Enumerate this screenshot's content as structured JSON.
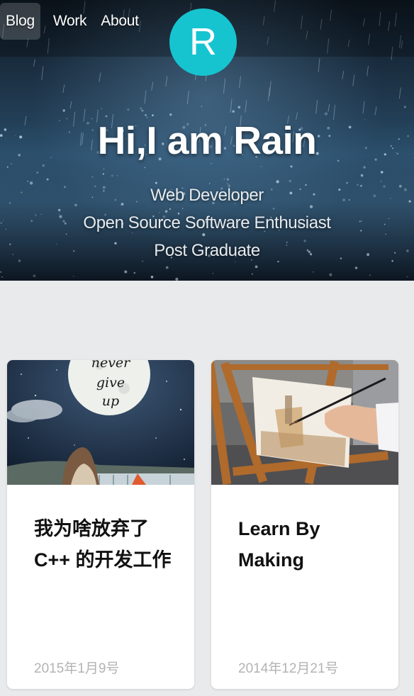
{
  "nav": {
    "items": [
      {
        "label": "Blog",
        "active": true
      },
      {
        "label": "Work",
        "active": false
      },
      {
        "label": "About",
        "active": false
      }
    ]
  },
  "avatar": {
    "letter": "R",
    "color": "#16c4d0"
  },
  "hero": {
    "title": "Hi,I am Rain",
    "subtitle_lines": [
      "Web Developer",
      "Open Source Software Enthusiast",
      "Post Graduate"
    ]
  },
  "posts": [
    {
      "title": "我为啥放弃了C++ 的开发工作",
      "date": "2015年1月9号",
      "image_text": [
        "never",
        "give",
        "up"
      ]
    },
    {
      "title": "Learn By Making",
      "date": "2014年12月21号"
    }
  ],
  "colors": {
    "page_bg": "#e9eaec",
    "accent": "#16c4d0",
    "date_text": "#b3b3b3"
  }
}
